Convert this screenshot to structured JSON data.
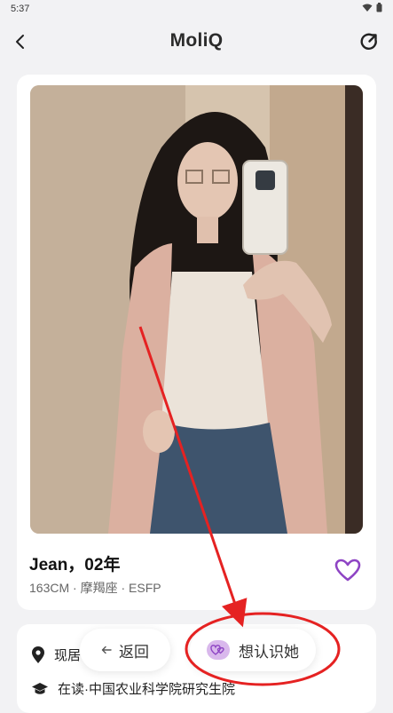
{
  "status_bar": {
    "time": "5:37"
  },
  "header": {
    "logo": "MoliQ"
  },
  "profile": {
    "name": "Jean，02年",
    "meta": "163CM · 摩羯座 · ESFP"
  },
  "info": {
    "location_prefix": "现居",
    "education": "在读·中国农业科学院研究生院"
  },
  "actions": {
    "back_label": "返回",
    "meet_label": "想认识她"
  },
  "colors": {
    "accent": "#8e44c4",
    "annotation_red": "#e52222"
  },
  "icons": [
    "chevron-left-icon",
    "refresh-icon",
    "heart-outline-icon",
    "location-pin-icon",
    "graduation-cap-icon",
    "arrow-left-icon",
    "hearts-icon"
  ]
}
